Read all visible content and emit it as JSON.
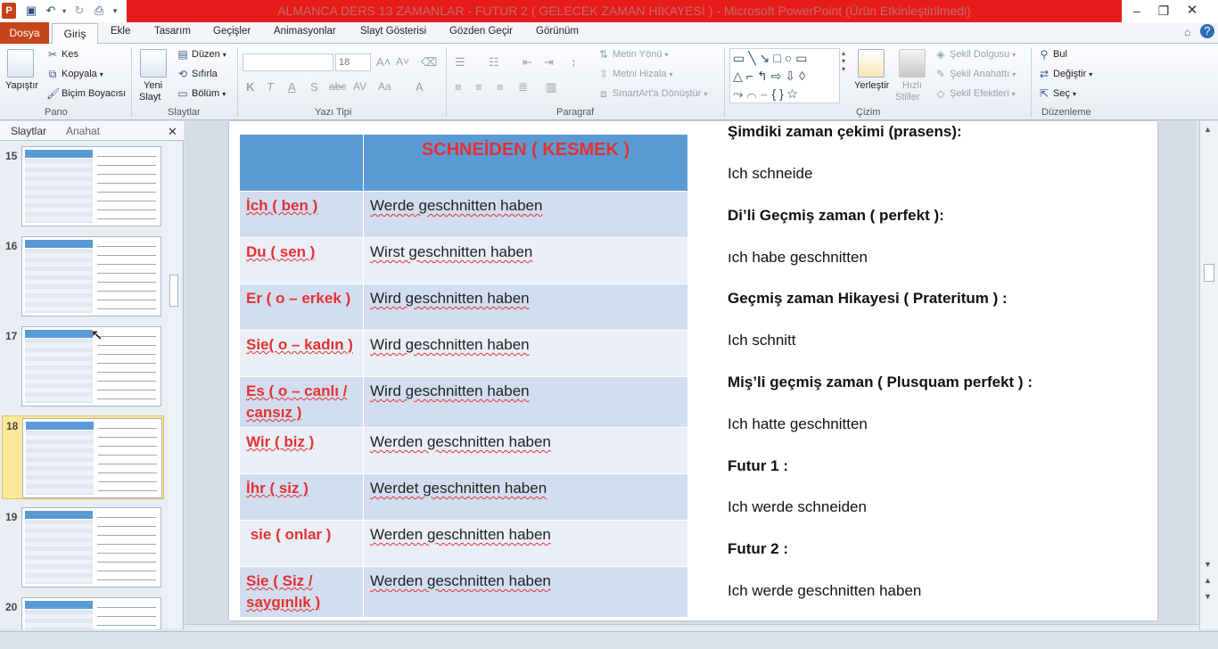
{
  "window": {
    "title": "ALMANCA DERS 13 ZAMANLAR - FUTUR 2 ( GELECEK ZAMAN HİKAYESİ ) - Microsoft PowerPoint (Ürün Etkinleştirilmedi)",
    "app_logo": "P"
  },
  "tabs": {
    "file": "Dosya",
    "items": [
      "Giriş",
      "Ekle",
      "Tasarım",
      "Geçişler",
      "Animasyonlar",
      "Slayt Gösterisi",
      "Gözden Geçir",
      "Görünüm"
    ]
  },
  "ribbon": {
    "clipboard": {
      "paste": "Yapıştır",
      "cut": "Kes",
      "copy": "Kopyala",
      "format_painter": "Biçim Boyacısı",
      "label": "Pano"
    },
    "slides": {
      "new_slide_1": "Yeni",
      "new_slide_2": "Slayt",
      "layout": "Düzen",
      "reset": "Sıfırla",
      "section": "Bölüm",
      "label": "Slaytlar"
    },
    "font": {
      "size": "18",
      "label": "Yazı Tipi"
    },
    "paragraph": {
      "text_direction": "Metin Yönü",
      "align_text": "Metni Hizala",
      "smartart": "SmartArt'a Dönüştür",
      "label": "Paragraf"
    },
    "drawing": {
      "arrange_1": "Yerleştir",
      "quick_styles_1": "Hızlı",
      "quick_styles_2": "Stiller",
      "shape_fill": "Şekil Dolgusu",
      "shape_outline": "Şekil Anahattı",
      "shape_effects": "Şekil Efektleri",
      "label": "Çizim"
    },
    "editing": {
      "find": "Bul",
      "replace": "Değiştir",
      "select": "Seç",
      "label": "Düzenleme"
    }
  },
  "left_pane": {
    "tab_slides": "Slaytlar",
    "tab_outline": "Anahat",
    "slide_numbers": [
      "15",
      "16",
      "17",
      "18",
      "19",
      "20"
    ],
    "selected": "18"
  },
  "slide": {
    "table_header": "SCHNEİDEN ( KESMEK  )",
    "rows": [
      {
        "pronoun": "İch ( ben )",
        "verb": "Werde geschnitten haben"
      },
      {
        "pronoun": "Du ( sen )",
        "verb": "Wirst geschnitten haben"
      },
      {
        "pronoun": "Er ( o – erkek )",
        "verb": "Wird geschnitten haben"
      },
      {
        "pronoun": "Sie( o – kadın )",
        "verb": "Wird geschnitten haben"
      },
      {
        "pronoun": "Es ( o – canlı / cansız )",
        "verb": "Wird geschnitten haben"
      },
      {
        "pronoun": "Wir ( biz )",
        "verb": "Werden geschnitten haben"
      },
      {
        "pronoun": "İhr ( siz )",
        "verb": "Werdet geschnitten haben"
      },
      {
        "pronoun": " sie ( onlar )",
        "verb": "Werden geschnitten haben"
      },
      {
        "pronoun": "Sie ( Siz / saygınlık )",
        "verb": "Werden geschnitten haben"
      }
    ],
    "right_lines": [
      {
        "text": "Şimdiki zaman çekimi (prasens):",
        "bold": true
      },
      {
        "text": "Ich schneide",
        "bold": false
      },
      {
        "text": "Di’li Geçmiş zaman ( perfekt ):",
        "bold": true
      },
      {
        "text": "ıch habe geschnitten",
        "bold": false
      },
      {
        "text": "Geçmiş zaman Hikayesi ( Prateritum ) :",
        "bold": true
      },
      {
        "text": "Ich schnitt",
        "bold": false
      },
      {
        "text": "Miş’li geçmiş zaman  ( Plusquam perfekt ) :",
        "bold": true
      },
      {
        "text": "Ich hatte geschnitten",
        "bold": false
      },
      {
        "text": "Futur 1 :",
        "bold": true
      },
      {
        "text": "Ich werde schneiden",
        "bold": false
      },
      {
        "text": "Futur 2 :",
        "bold": true
      },
      {
        "text": "Ich werde geschnitten haben",
        "bold": false
      }
    ]
  },
  "colors": {
    "accent_red": "#e81b1b",
    "file_tab": "#c6441a",
    "table_header": "#5b9bd5",
    "pronoun_red": "#e53030"
  }
}
